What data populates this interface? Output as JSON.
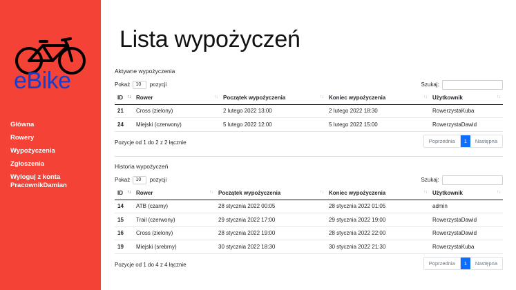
{
  "brand": {
    "logo_text": "eBike"
  },
  "nav": [
    {
      "label": "Główna"
    },
    {
      "label": "Rowery"
    },
    {
      "label": "Wypożyczenia"
    },
    {
      "label": "Zgłoszenia"
    },
    {
      "label": "Wyloguj z konta PracownikDamian"
    }
  ],
  "page_title": "Lista wypożyczeń",
  "active": {
    "title": "Aktywne wypożyczenia",
    "show_prefix": "Pokaż",
    "show_value": "10",
    "show_suffix": "pozycji",
    "search_label": "Szukaj:",
    "columns": [
      "ID",
      "Rower",
      "Początek wypożyczenia",
      "Koniec wypożyczenia",
      "Użytkownik"
    ],
    "rows": [
      [
        "21",
        "Cross (zielony)",
        "2 lutego 2022 13:00",
        "2 lutego 2022 18:30",
        "RowerzystaKuba"
      ],
      [
        "24",
        "Miejski (czerwony)",
        "5 lutego 2022 12:00",
        "5 lutego 2022 15:00",
        "RowerzystaDawid"
      ]
    ],
    "info": "Pozycje od 1 do 2 z 2 łącznie",
    "prev": "Poprzednia",
    "page": "1",
    "next": "Następna"
  },
  "history": {
    "title": "Historia wypożyczeń",
    "show_prefix": "Pokaż",
    "show_value": "10",
    "show_suffix": "pozycji",
    "search_label": "Szukaj:",
    "columns": [
      "ID",
      "Rower",
      "Początek wypożyczenia",
      "Koniec wypożyczenia",
      "Użytkownik"
    ],
    "rows": [
      [
        "14",
        "ATB (czarny)",
        "28 stycznia 2022 00:05",
        "28 stycznia 2022 01:05",
        "admin"
      ],
      [
        "15",
        "Trail (czerwony)",
        "29 stycznia 2022 17:00",
        "29 stycznia 2022 19:00",
        "RowerzystaDawid"
      ],
      [
        "16",
        "Cross (zielony)",
        "28 stycznia 2022 19:00",
        "28 stycznia 2022 22:00",
        "RowerzystaDawid"
      ],
      [
        "19",
        "Miejski (srebrny)",
        "30 stycznia 2022 18:30",
        "30 stycznia 2022 21:30",
        "RowerzystaKuba"
      ]
    ],
    "info": "Pozycje od 1 do 4 z 4 łącznie",
    "prev": "Poprzednia",
    "page": "1",
    "next": "Następna"
  },
  "colors": {
    "sidebar": "#f44336",
    "logo_text": "#1a3ec9",
    "page_active": "#0d6efd"
  },
  "icons": {
    "logo": "bicycle-icon",
    "sort": "sort-arrows-icon"
  }
}
